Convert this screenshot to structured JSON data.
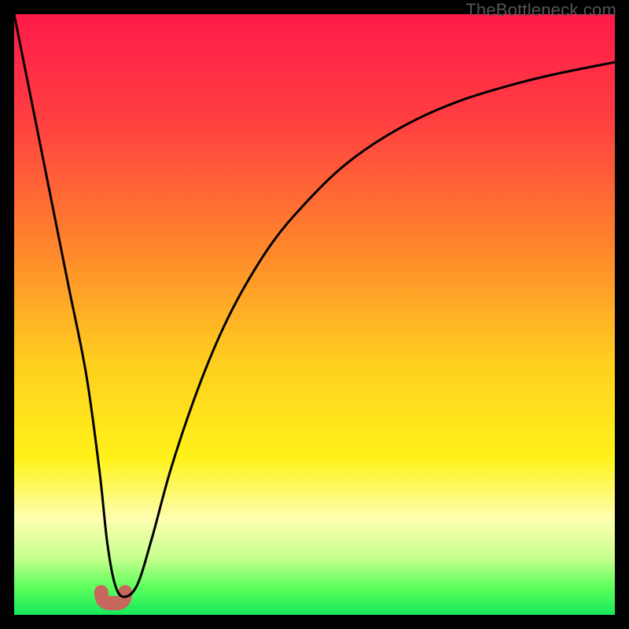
{
  "watermark": "TheBottleneck.com",
  "chart_data": {
    "type": "line",
    "title": "",
    "xlabel": "",
    "ylabel": "",
    "xlim": [
      0,
      100
    ],
    "ylim": [
      0,
      100
    ],
    "series": [
      {
        "name": "curve",
        "x": [
          0,
          3,
          6,
          9,
          12,
          14.2,
          15.5,
          16.8,
          18.3,
          20.5,
          23,
          26,
          30,
          34,
          38,
          43,
          48,
          54,
          60,
          67,
          74,
          82,
          90,
          100
        ],
        "y": [
          100,
          85,
          70,
          55,
          40,
          24,
          12,
          5,
          3,
          5,
          13,
          24,
          36,
          46,
          54,
          62,
          68,
          74,
          78.5,
          82.5,
          85.5,
          88,
          90,
          92
        ]
      }
    ],
    "marker": {
      "name": "bump",
      "x_range": [
        14.5,
        18.5
      ],
      "y": 3,
      "color": "#c7675e"
    },
    "background_gradient": {
      "stops": [
        {
          "offset": 0.0,
          "color": "#ff1a4a"
        },
        {
          "offset": 0.18,
          "color": "#ff4040"
        },
        {
          "offset": 0.4,
          "color": "#ff8a2b"
        },
        {
          "offset": 0.58,
          "color": "#ffcf1f"
        },
        {
          "offset": 0.74,
          "color": "#fff21a"
        },
        {
          "offset": 0.84,
          "color": "#feffb0"
        },
        {
          "offset": 0.905,
          "color": "#c8ff8f"
        },
        {
          "offset": 0.955,
          "color": "#5bff5b"
        },
        {
          "offset": 1.0,
          "color": "#16e85a"
        }
      ]
    }
  }
}
